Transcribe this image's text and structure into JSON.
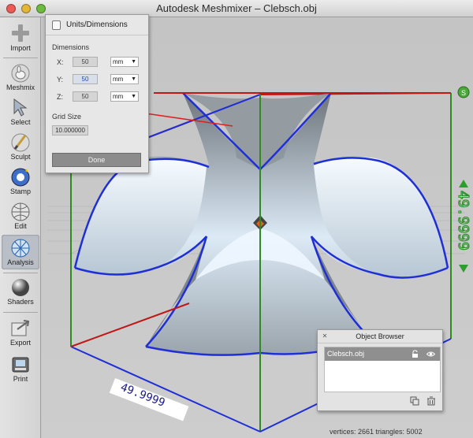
{
  "window": {
    "title": "Autodesk Meshmixer – Clebsch.obj"
  },
  "toolbar": {
    "items": [
      {
        "label": "Import",
        "icon": "plus-icon"
      },
      {
        "label": "Meshmix",
        "icon": "bunny-icon"
      },
      {
        "label": "Select",
        "icon": "arrow-cursor-icon"
      },
      {
        "label": "Sculpt",
        "icon": "brush-icon"
      },
      {
        "label": "Stamp",
        "icon": "stamp-icon"
      },
      {
        "label": "Edit",
        "icon": "edit-sphere-icon"
      },
      {
        "label": "Analysis",
        "icon": "analysis-sphere-icon",
        "active": true
      },
      {
        "label": "Shaders",
        "icon": "shader-sphere-icon"
      },
      {
        "label": "Export",
        "icon": "export-icon"
      },
      {
        "label": "Print",
        "icon": "printer-icon"
      }
    ]
  },
  "units_panel": {
    "title": "Units/Dimensions",
    "dimensions_label": "Dimensions",
    "x_label": "X:",
    "x_value": "50",
    "x_unit": "mm",
    "y_label": "Y:",
    "y_value": "50",
    "y_unit": "mm",
    "z_label": "Z:",
    "z_value": "50",
    "z_unit": "mm",
    "grid_size_label": "Grid Size",
    "grid_size_value": "10.000000",
    "done_label": "Done"
  },
  "viewport": {
    "dimension_right": "49.9999",
    "dimension_bottom": "49.9999",
    "colors": {
      "bbox_top": "#1f2fd6",
      "bbox_vertical": "#2e8b1f",
      "bbox_bottom": "#c01818",
      "surface_edge": "#1f2fd6",
      "annotation_arrow": "#e02020"
    }
  },
  "object_browser": {
    "title": "Object Browser",
    "items": [
      {
        "name": "Clebsch.obj"
      }
    ]
  },
  "status": {
    "text": "vertices: 2661 triangles: 5002"
  }
}
